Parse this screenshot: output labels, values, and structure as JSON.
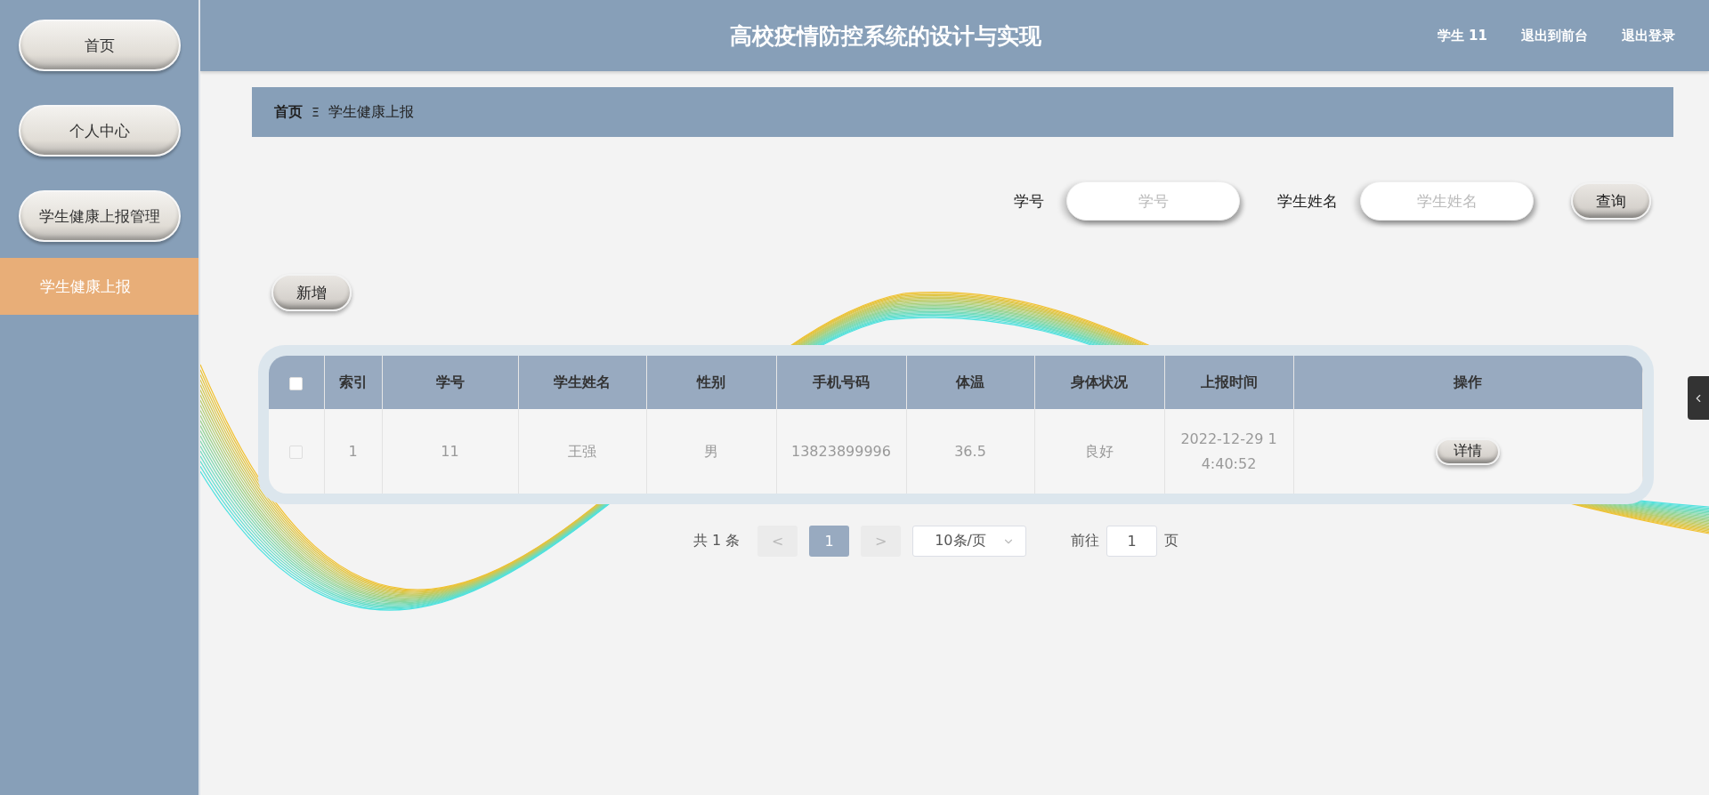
{
  "header": {
    "title": "高校疫情防控系统的设计与实现",
    "user": "学生 11",
    "links": [
      "退出到前台",
      "退出登录"
    ]
  },
  "sidebar": {
    "items": [
      {
        "label": "首页",
        "selected": false
      },
      {
        "label": "个人中心",
        "selected": false
      },
      {
        "label": "学生健康上报管理",
        "selected": false,
        "children": [
          {
            "label": "学生健康上报",
            "selected": true
          }
        ]
      }
    ]
  },
  "breadcrumb": {
    "items": [
      "首页",
      "学生健康上报"
    ],
    "separator": "Ξ"
  },
  "search": {
    "fields": [
      {
        "label": "学号",
        "placeholder": "学号"
      },
      {
        "label": "学生姓名",
        "placeholder": "学生姓名"
      }
    ],
    "button": "查询"
  },
  "add_button": "新增",
  "table": {
    "all_checked": false,
    "columns": [
      "索引",
      "学号",
      "学生姓名",
      "性别",
      "手机号码",
      "体温",
      "身体状况",
      "上报时间",
      "操作"
    ],
    "rows": [
      {
        "checked": false,
        "cells": [
          "1",
          "11",
          "王强",
          "男",
          "13823899996",
          "36.5",
          "良好",
          "2022-12-29 14:40:52"
        ],
        "action": "详情"
      }
    ]
  },
  "pagination": {
    "total": "共 1 条",
    "prev": "<",
    "pages": [
      {
        "label": "1",
        "selected": true
      }
    ],
    "next": ">",
    "page_size": "10条/页",
    "goto_label": "前往",
    "goto_value": "1",
    "goto_suffix": "页"
  }
}
